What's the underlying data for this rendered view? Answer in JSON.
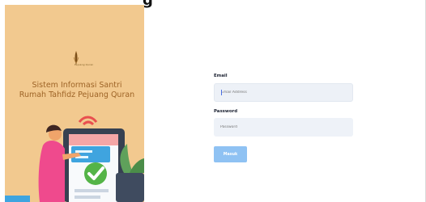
{
  "header": {
    "cut_off_text": "g"
  },
  "brand": {
    "logo_icon": "quran-pen-logo-icon",
    "logo_text": "Pejuang Quran",
    "title_line_1": "Sistem Informasi Santri",
    "title_line_2": "Rumah Tahfidz Pejuang Quran"
  },
  "login_form": {
    "email_label": "Email",
    "email_placeholder": "Email Address",
    "password_label": "Password",
    "password_placeholder": "Password",
    "submit_label": "Masuk"
  },
  "colors": {
    "panel_background": "#f2c98f",
    "brand_text": "#9e6427",
    "input_background": "#edf1f7",
    "button_background": "#8fc2f3"
  }
}
